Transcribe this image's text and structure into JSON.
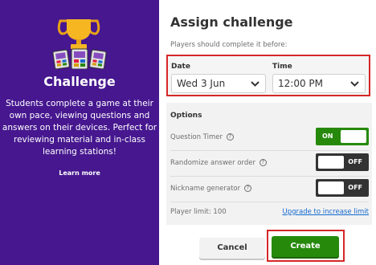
{
  "left_panel": {
    "title": "Challenge",
    "description": "Students complete a game at their own pace, viewing questions and answers on their devices. Perfect for reviewing material and in-class learning stations!",
    "learn_more": "Learn more",
    "icons": [
      "trophy-icon",
      "devices-icon"
    ]
  },
  "header": {
    "title": "Assign challenge",
    "subtitle": "Players should complete it before:"
  },
  "deadline": {
    "date_label": "Date",
    "date_value": "Wed 3 Jun",
    "time_label": "Time",
    "time_value": "12:00 PM"
  },
  "options": {
    "title": "Options",
    "items": [
      {
        "label": "Question Timer",
        "state": "ON"
      },
      {
        "label": "Randomize answer order",
        "state": "OFF"
      },
      {
        "label": "Nickname generator",
        "state": "OFF"
      }
    ],
    "player_limit": "Player limit: 100",
    "upgrade_link": "Upgrade to increase limit"
  },
  "actions": {
    "cancel": "Cancel",
    "create": "Create"
  },
  "colors": {
    "panel": "#46178f",
    "on": "#26890c",
    "off": "#333333",
    "highlight": "#d52727",
    "link": "#1368ce"
  }
}
